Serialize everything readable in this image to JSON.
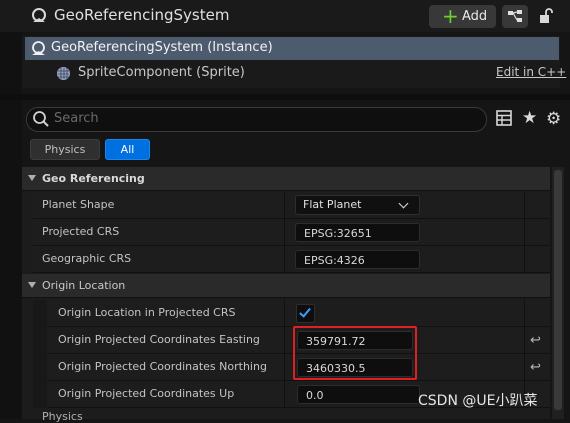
{
  "header": {
    "title": "GeoReferencingSystem",
    "add_label": "Add"
  },
  "tree": {
    "instance_label": "GeoReferencingSystem (Instance)",
    "component_label": "SpriteComponent (Sprite)",
    "edit_link": "Edit in C++"
  },
  "search": {
    "placeholder": "Search"
  },
  "filters": {
    "physics": "Physics",
    "all": "All"
  },
  "sections": {
    "geo_referencing": "Geo Referencing",
    "origin_location": "Origin Location",
    "physics_cut": "Physics"
  },
  "properties": {
    "planet_shape": {
      "label": "Planet Shape",
      "value": "Flat Planet"
    },
    "projected_crs": {
      "label": "Projected CRS",
      "value": "EPSG:32651"
    },
    "geographic_crs": {
      "label": "Geographic CRS",
      "value": "EPSG:4326"
    },
    "origin_in_projected": {
      "label": "Origin Location in Projected CRS",
      "checked": true
    },
    "easting": {
      "label": "Origin Projected Coordinates Easting",
      "value": "359791.72"
    },
    "northing": {
      "label": "Origin Projected Coordinates Northing",
      "value": "3460330.5"
    },
    "up": {
      "label": "Origin Projected Coordinates Up",
      "value": "0.0"
    }
  },
  "watermark": "CSDN @UE小趴菜",
  "colors": {
    "accent": "#0070e0",
    "highlight": "#e02020",
    "add_plus": "#6fcf2f"
  }
}
